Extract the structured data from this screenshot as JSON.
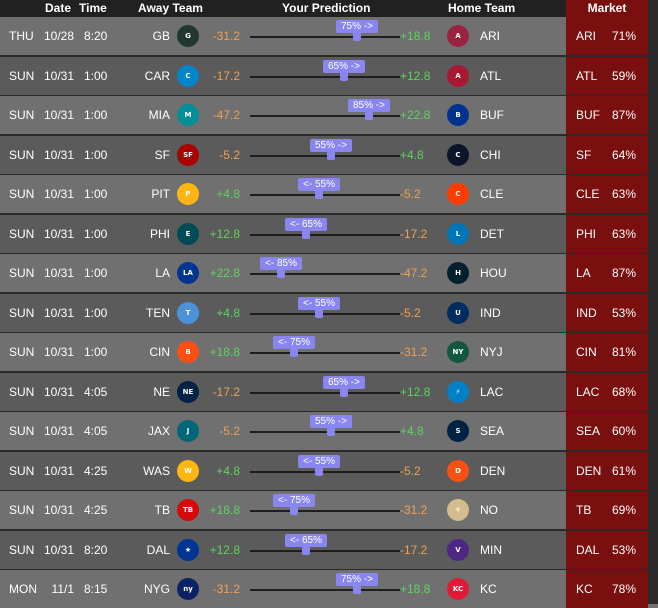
{
  "headers": {
    "date": "Date",
    "time": "Time",
    "away_team": "Away Team",
    "prediction": "Your Prediction",
    "home_team": "Home Team",
    "market": "Market"
  },
  "colors": {
    "positive": "#5dd55d",
    "negative": "#f0a050",
    "slider": "#8a86f0",
    "market_bg": "#7a0f0f"
  },
  "games": [
    {
      "day": "THU",
      "date": "10/28",
      "time": "8:20",
      "away": "GB",
      "away_spread": "-31.2",
      "prediction_label": "75% ->",
      "pick_side": "home",
      "pick_pct": 75,
      "home_spread": "+18.8",
      "home": "ARI",
      "market_team": "ARI",
      "market_pct": "71%"
    },
    {
      "day": "SUN",
      "date": "10/31",
      "time": "1:00",
      "away": "CAR",
      "away_spread": "-17.2",
      "prediction_label": "65% ->",
      "pick_side": "home",
      "pick_pct": 65,
      "home_spread": "+12.8",
      "home": "ATL",
      "market_team": "ATL",
      "market_pct": "59%"
    },
    {
      "day": "SUN",
      "date": "10/31",
      "time": "1:00",
      "away": "MIA",
      "away_spread": "-47.2",
      "prediction_label": "85% ->",
      "pick_side": "home",
      "pick_pct": 85,
      "home_spread": "+22.8",
      "home": "BUF",
      "market_team": "BUF",
      "market_pct": "87%"
    },
    {
      "day": "SUN",
      "date": "10/31",
      "time": "1:00",
      "away": "SF",
      "away_spread": "-5.2",
      "prediction_label": "55% ->",
      "pick_side": "home",
      "pick_pct": 55,
      "home_spread": "+4.8",
      "home": "CHI",
      "market_team": "SF",
      "market_pct": "64%"
    },
    {
      "day": "SUN",
      "date": "10/31",
      "time": "1:00",
      "away": "PIT",
      "away_spread": "+4.8",
      "prediction_label": "<- 55%",
      "pick_side": "away",
      "pick_pct": 55,
      "home_spread": "-5.2",
      "home": "CLE",
      "market_team": "CLE",
      "market_pct": "63%"
    },
    {
      "day": "SUN",
      "date": "10/31",
      "time": "1:00",
      "away": "PHI",
      "away_spread": "+12.8",
      "prediction_label": "<- 65%",
      "pick_side": "away",
      "pick_pct": 65,
      "home_spread": "-17.2",
      "home": "DET",
      "market_team": "PHI",
      "market_pct": "63%"
    },
    {
      "day": "SUN",
      "date": "10/31",
      "time": "1:00",
      "away": "LA",
      "away_spread": "+22.8",
      "prediction_label": "<- 85%",
      "pick_side": "away",
      "pick_pct": 85,
      "home_spread": "-47.2",
      "home": "HOU",
      "market_team": "LA",
      "market_pct": "87%"
    },
    {
      "day": "SUN",
      "date": "10/31",
      "time": "1:00",
      "away": "TEN",
      "away_spread": "+4.8",
      "prediction_label": "<- 55%",
      "pick_side": "away",
      "pick_pct": 55,
      "home_spread": "-5.2",
      "home": "IND",
      "market_team": "IND",
      "market_pct": "53%"
    },
    {
      "day": "SUN",
      "date": "10/31",
      "time": "1:00",
      "away": "CIN",
      "away_spread": "+18.8",
      "prediction_label": "<- 75%",
      "pick_side": "away",
      "pick_pct": 75,
      "home_spread": "-31.2",
      "home": "NYJ",
      "market_team": "CIN",
      "market_pct": "81%"
    },
    {
      "day": "SUN",
      "date": "10/31",
      "time": "4:05",
      "away": "NE",
      "away_spread": "-17.2",
      "prediction_label": "65% ->",
      "pick_side": "home",
      "pick_pct": 65,
      "home_spread": "+12.8",
      "home": "LAC",
      "market_team": "LAC",
      "market_pct": "68%"
    },
    {
      "day": "SUN",
      "date": "10/31",
      "time": "4:05",
      "away": "JAX",
      "away_spread": "-5.2",
      "prediction_label": "55% ->",
      "pick_side": "home",
      "pick_pct": 55,
      "home_spread": "+4.8",
      "home": "SEA",
      "market_team": "SEA",
      "market_pct": "60%"
    },
    {
      "day": "SUN",
      "date": "10/31",
      "time": "4:25",
      "away": "WAS",
      "away_spread": "+4.8",
      "prediction_label": "<- 55%",
      "pick_side": "away",
      "pick_pct": 55,
      "home_spread": "-5.2",
      "home": "DEN",
      "market_team": "DEN",
      "market_pct": "61%"
    },
    {
      "day": "SUN",
      "date": "10/31",
      "time": "4:25",
      "away": "TB",
      "away_spread": "+18.8",
      "prediction_label": "<- 75%",
      "pick_side": "away",
      "pick_pct": 75,
      "home_spread": "-31.2",
      "home": "NO",
      "market_team": "TB",
      "market_pct": "69%"
    },
    {
      "day": "SUN",
      "date": "10/31",
      "time": "8:20",
      "away": "DAL",
      "away_spread": "+12.8",
      "prediction_label": "<- 65%",
      "pick_side": "away",
      "pick_pct": 65,
      "home_spread": "-17.2",
      "home": "MIN",
      "market_team": "DAL",
      "market_pct": "53%"
    },
    {
      "day": "MON",
      "date": "11/1",
      "time": "8:15",
      "away": "NYG",
      "away_spread": "-31.2",
      "prediction_label": "75% ->",
      "pick_side": "home",
      "pick_pct": 75,
      "home_spread": "+18.8",
      "home": "KC",
      "market_team": "KC",
      "market_pct": "78%"
    }
  ],
  "logos": {
    "GB": {
      "icon": "packers-logo-icon",
      "color": "#203731",
      "glyph": "G"
    },
    "CAR": {
      "icon": "panthers-logo-icon",
      "color": "#0085ca",
      "glyph": "C"
    },
    "MIA": {
      "icon": "dolphins-logo-icon",
      "color": "#008e97",
      "glyph": "M"
    },
    "SF": {
      "icon": "49ers-logo-icon",
      "color": "#aa0000",
      "glyph": "SF"
    },
    "PIT": {
      "icon": "steelers-logo-icon",
      "color": "#ffb612",
      "glyph": "P"
    },
    "PHI": {
      "icon": "eagles-logo-icon",
      "color": "#004c54",
      "glyph": "E"
    },
    "LA": {
      "icon": "rams-logo-icon",
      "color": "#003594",
      "glyph": "LA"
    },
    "TEN": {
      "icon": "titans-logo-icon",
      "color": "#4b92db",
      "glyph": "T"
    },
    "CIN": {
      "icon": "bengals-logo-icon",
      "color": "#fb4f14",
      "glyph": "B"
    },
    "NE": {
      "icon": "patriots-logo-icon",
      "color": "#002244",
      "glyph": "NE"
    },
    "JAX": {
      "icon": "jaguars-logo-icon",
      "color": "#006778",
      "glyph": "J"
    },
    "WAS": {
      "icon": "commanders-logo-icon",
      "color": "#ffb612",
      "glyph": "W"
    },
    "TB": {
      "icon": "buccaneers-logo-icon",
      "color": "#d50a0a",
      "glyph": "TB"
    },
    "DAL": {
      "icon": "cowboys-logo-icon",
      "color": "#003594",
      "glyph": "★"
    },
    "NYG": {
      "icon": "giants-logo-icon",
      "color": "#0b2265",
      "glyph": "ny"
    },
    "ARI": {
      "icon": "cardinals-logo-icon",
      "color": "#97233f",
      "glyph": "A"
    },
    "ATL": {
      "icon": "falcons-logo-icon",
      "color": "#a71930",
      "glyph": "A"
    },
    "BUF": {
      "icon": "bills-logo-icon",
      "color": "#00338d",
      "glyph": "B"
    },
    "CHI": {
      "icon": "bears-logo-icon",
      "color": "#0b162a",
      "glyph": "C"
    },
    "CLE": {
      "icon": "browns-logo-icon",
      "color": "#ff3c00",
      "glyph": "C"
    },
    "DET": {
      "icon": "lions-logo-icon",
      "color": "#0076b6",
      "glyph": "L"
    },
    "HOU": {
      "icon": "texans-logo-icon",
      "color": "#03202f",
      "glyph": "H"
    },
    "IND": {
      "icon": "colts-logo-icon",
      "color": "#002c5f",
      "glyph": "U"
    },
    "NYJ": {
      "icon": "jets-logo-icon",
      "color": "#125740",
      "glyph": "NY"
    },
    "LAC": {
      "icon": "chargers-logo-icon",
      "color": "#0080c6",
      "glyph": "⚡"
    },
    "SEA": {
      "icon": "seahawks-logo-icon",
      "color": "#002244",
      "glyph": "S"
    },
    "DEN": {
      "icon": "broncos-logo-icon",
      "color": "#fb4f14",
      "glyph": "D"
    },
    "NO": {
      "icon": "saints-logo-icon",
      "color": "#d3bc8d",
      "glyph": "⚜"
    },
    "MIN": {
      "icon": "vikings-logo-icon",
      "color": "#4f2683",
      "glyph": "V"
    },
    "KC": {
      "icon": "chiefs-logo-icon",
      "color": "#e31837",
      "glyph": "KC"
    }
  }
}
